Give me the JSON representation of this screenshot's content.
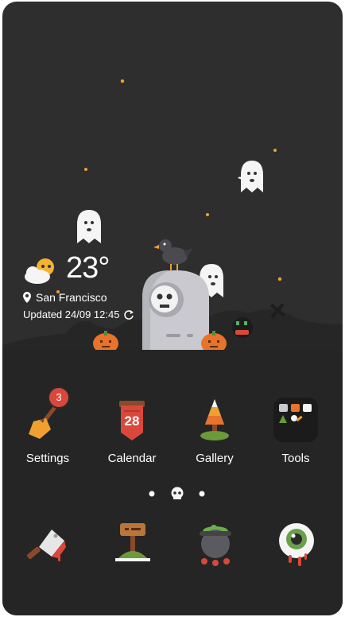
{
  "weather": {
    "temperature": "23°",
    "location": "San Francisco",
    "updated": "Updated 24/09 12:45",
    "icon": "partly-cloudy-icon"
  },
  "apps": [
    {
      "label": "Settings",
      "icon": "broom-icon",
      "badge": "3"
    },
    {
      "label": "Calendar",
      "icon": "calendar-icon",
      "date": "28"
    },
    {
      "label": "Gallery",
      "icon": "candy-corn-icon"
    },
    {
      "label": "Tools",
      "icon": "folder-icon"
    }
  ],
  "dock": [
    {
      "icon": "cleaver-icon"
    },
    {
      "icon": "signpost-icon"
    },
    {
      "icon": "cauldron-icon"
    },
    {
      "icon": "eyeball-icon"
    }
  ],
  "page_indicator": {
    "pages": 3,
    "current": 2
  },
  "colors": {
    "background": "#2e2e2e",
    "ground": "#252525",
    "accent_orange": "#e8732a",
    "badge_red": "#d9483b",
    "star_orange": "#f0a030"
  }
}
